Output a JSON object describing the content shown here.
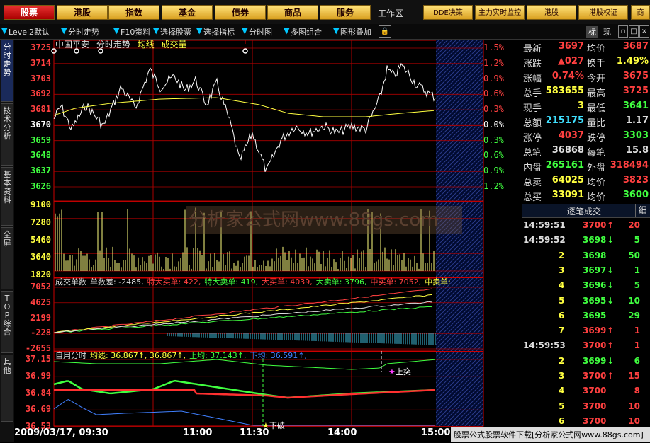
{
  "nav": {
    "buttons": [
      "股票",
      "港股",
      "指数",
      "基金",
      "债券",
      "商品",
      "服务"
    ],
    "worklabel": "工作区",
    "right_buttons": [
      "DDE决策",
      "主力实时监控",
      "港股",
      "港股权证",
      "商"
    ]
  },
  "toolbar": {
    "items": [
      "Level2默认",
      "分时走势",
      "F10资料",
      "选择股票",
      "选择指标",
      "分时图",
      "多图组合",
      "图形叠加"
    ],
    "right": [
      "标",
      "现"
    ]
  },
  "sidetabs": [
    "分时走势",
    "技术分析",
    "基本资料",
    "全屏",
    "TOP综合",
    "其他"
  ],
  "chart": {
    "stock": "中国平安",
    "mode": "分时走势",
    "avg_label": "均线",
    "vol_label": "成交量",
    "price_ticks": [
      "3725",
      "3714",
      "3703",
      "3692",
      "3681",
      "3670",
      "3659",
      "3648",
      "3637",
      "3626"
    ],
    "pct_ticks": [
      "1.5%",
      "1.2%",
      "0.9%",
      "0.6%",
      "0.3%",
      "0.0%",
      "0.3%",
      "0.6%",
      "0.9%",
      "1.2%"
    ],
    "vol_ticks": [
      "9100",
      "7280",
      "5460",
      "3640",
      "1820"
    ],
    "watermark": "分析家公式网www.88gs.com",
    "ind1": {
      "ticks": [
        "7052",
        "4625",
        "2199",
        "-228",
        "-2655"
      ],
      "legend": [
        {
          "text": "成交单数",
          "color": "#dddddd"
        },
        {
          "text": "单数差: -2485,",
          "color": "#dddddd"
        },
        {
          "text": "特大买单: 422,",
          "color": "#ff4040"
        },
        {
          "text": "特大卖单: 419,",
          "color": "#40ff40"
        },
        {
          "text": "大买单: 4039,",
          "color": "#ff4040"
        },
        {
          "text": "大卖单: 3796,",
          "color": "#40ff40"
        },
        {
          "text": "中买单: 7052,",
          "color": "#ff4040"
        },
        {
          "text": "中卖单:",
          "color": "#ffff40"
        }
      ]
    },
    "ind2": {
      "ticks": [
        "37.15",
        "36.99",
        "36.84",
        "36.69",
        "36.53"
      ],
      "legend": [
        {
          "text": "自用分时",
          "color": "#dddddd"
        },
        {
          "text": "均线: 36.867↑, 36.867↑,",
          "color": "#ffff40"
        },
        {
          "text": "上均: 37.143↑,",
          "color": "#40ff40"
        },
        {
          "text": "下均: 36.591↑,",
          "color": "#4080ff"
        }
      ],
      "signal_up": "上突",
      "signal_down": "下破"
    },
    "time_labels": [
      "2009/03/17, 09:30",
      "11:00",
      "11:30",
      "14:00",
      "15:00"
    ]
  },
  "quote": [
    {
      "l1": "最新",
      "v1": "3697",
      "c1": "#ff4040",
      "l2": "均价",
      "v2": "3687",
      "c2": "#ff4040"
    },
    {
      "l1": "涨跌",
      "v1": "▲027",
      "c1": "#ff4040",
      "l2": "换手",
      "v2": "1.49%",
      "c2": "#ffff40"
    },
    {
      "l1": "涨幅",
      "v1": "0.74%",
      "c1": "#ff4040",
      "l2": "今开",
      "v2": "3675",
      "c2": "#ff4040"
    },
    {
      "l1": "总手",
      "v1": "583655",
      "c1": "#ffff40",
      "l2": "最高",
      "v2": "3725",
      "c2": "#ff4040"
    },
    {
      "l1": "现手",
      "v1": "3",
      "c1": "#ffff40",
      "l2": "最低",
      "v2": "3641",
      "c2": "#40ff40"
    },
    {
      "l1": "总额",
      "v1": "215175",
      "c1": "#40e0ff",
      "l2": "量比",
      "v2": "1.17",
      "c2": "#dddddd"
    },
    {
      "l1": "涨停",
      "v1": "4037",
      "c1": "#ff4040",
      "l2": "跌停",
      "v2": "3303",
      "c2": "#40ff40"
    },
    {
      "l1": "总笔",
      "v1": "36868",
      "c1": "#dddddd",
      "l2": "每笔",
      "v2": "15.8",
      "c2": "#dddddd"
    },
    {
      "l1": "内盘",
      "v1": "265161",
      "c1": "#40ff40",
      "l2": "外盘",
      "v2": "318494",
      "c2": "#ff4040"
    },
    {
      "l1": "总卖",
      "v1": "64025",
      "c1": "#ffff40",
      "l2": "均价",
      "v2": "3823",
      "c2": "#ff4040"
    },
    {
      "l1": "总买",
      "v1": "33091",
      "c1": "#ffff40",
      "l2": "均价",
      "v2": "3600",
      "c2": "#40ff40"
    }
  ],
  "trades_header": "逐笔成交",
  "trades_side": "细",
  "trades": [
    {
      "t": "14:59:51",
      "p": "3700",
      "d": "↑",
      "dc": "#ff4040",
      "v": "20",
      "vc": "#ff4040"
    },
    {
      "t": "14:59:52",
      "p": "3698",
      "d": "↓",
      "dc": "#40ff40",
      "v": "5",
      "vc": "#40ff40"
    },
    {
      "t": "2",
      "p": "3698",
      "d": "",
      "dc": "#40ff40",
      "v": "50",
      "vc": "#40ff40"
    },
    {
      "t": "3",
      "p": "3697",
      "d": "↓",
      "dc": "#40ff40",
      "v": "1",
      "vc": "#40ff40"
    },
    {
      "t": "4",
      "p": "3696",
      "d": "↓",
      "dc": "#40ff40",
      "v": "5",
      "vc": "#40ff40"
    },
    {
      "t": "5",
      "p": "3695",
      "d": "↓",
      "dc": "#40ff40",
      "v": "10",
      "vc": "#40ff40"
    },
    {
      "t": "6",
      "p": "3695",
      "d": "",
      "dc": "#40ff40",
      "v": "29",
      "vc": "#40ff40"
    },
    {
      "t": "7",
      "p": "3699",
      "d": "↑",
      "dc": "#ff4040",
      "v": "1",
      "vc": "#ff4040"
    },
    {
      "t": "14:59:53",
      "p": "3700",
      "d": "↑",
      "dc": "#ff4040",
      "v": "1",
      "vc": "#ff4040"
    },
    {
      "t": "2",
      "p": "3699",
      "d": "↓",
      "dc": "#40ff40",
      "v": "6",
      "vc": "#40ff40"
    },
    {
      "t": "3",
      "p": "3700",
      "d": "↑",
      "dc": "#ff4040",
      "v": "15",
      "vc": "#ff4040"
    },
    {
      "t": "4",
      "p": "3700",
      "d": "",
      "dc": "#ff4040",
      "v": "8",
      "vc": "#ff4040"
    },
    {
      "t": "5",
      "p": "3700",
      "d": "",
      "dc": "#ff4040",
      "v": "10",
      "vc": "#ff4040"
    },
    {
      "t": "6",
      "p": "3700",
      "d": "",
      "dc": "#ff4040",
      "v": "10",
      "vc": "#ff4040"
    }
  ],
  "statusbar": "股票公式股票软件下载[分析家公式网www.88gs.com]"
}
